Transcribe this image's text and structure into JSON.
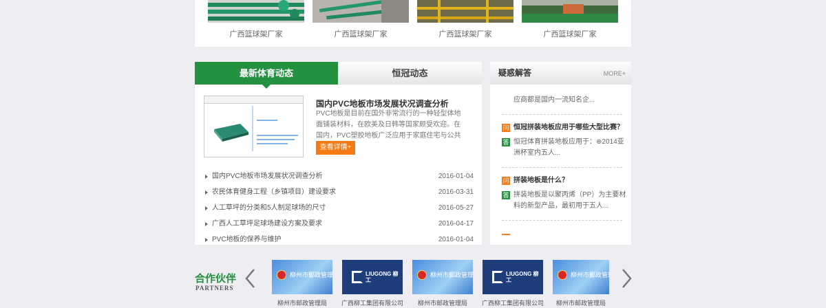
{
  "products": [
    {
      "caption": "广西篮球架厂家"
    },
    {
      "caption": "广西篮球架厂家"
    },
    {
      "caption": "广西篮球架厂家"
    },
    {
      "caption": "广西篮球架厂家"
    }
  ],
  "news": {
    "tabs": [
      {
        "label": "最新体育动态"
      },
      {
        "label": "恒冠动态"
      }
    ],
    "feature": {
      "title": "国内PVC地板市场发展状况调查分析",
      "description": "PVC地板是目前在国外非常流行的一种轻型体地面铺装材料，在欧美及日韩等国家颇受欢迎。在国内，PVC塑胶地板广泛应用于家庭住宅与公共场合的地面铺装，受到了消费者",
      "more_label": "查看详情+"
    },
    "items": [
      {
        "title": "国内PVC地板市场发展状况调查分析",
        "date": "2016-01-04"
      },
      {
        "title": "农民体育健身工程（乡镇项目）建设要求",
        "date": "2016-03-31"
      },
      {
        "title": "人工草坪的分类和5人制足球场的尺寸",
        "date": "2016-05-27"
      },
      {
        "title": "广西人工草坪足球场建设方案及要求",
        "date": "2016-04-17"
      },
      {
        "title": "PVC地板的保养与维护",
        "date": "2016-01-04"
      }
    ]
  },
  "qa": {
    "title": "疑惑解答",
    "more_label": "MORE+",
    "intro_text": "应商都是国内一流知名企...",
    "q_badge": "问",
    "a_badge": "答",
    "items": [
      {
        "question": "恒冠拼装地板应用于哪些大型比赛？",
        "answer": "恒冠体育拼装地板应用于：⊕2014亚洲杯室内五人..."
      },
      {
        "question": "拼装地板是什么？",
        "answer": "拼装地板是以聚丙烯（PP）为主要材料的新型产品，最初用于五人..."
      }
    ]
  },
  "partners": {
    "title": "合作伙伴",
    "subtitle": "PARTNERS",
    "items": [
      {
        "name": "柳州市邮政管理局",
        "logo_text": "柳州市郵政管理局"
      },
      {
        "name": "广西柳工集团有限公司",
        "logo_text": "LIUGONG 柳工"
      },
      {
        "name": "柳州市邮政管理局",
        "logo_text": "柳州市郵政管理局"
      },
      {
        "name": "广西柳工集团有限公司",
        "logo_text": "LIUGONG 柳工"
      },
      {
        "name": "柳州市邮政管理局",
        "logo_text": "柳州市郵政管理局"
      }
    ]
  },
  "colors": {
    "accent_green": "#23913f",
    "accent_orange": "#f47b16"
  }
}
